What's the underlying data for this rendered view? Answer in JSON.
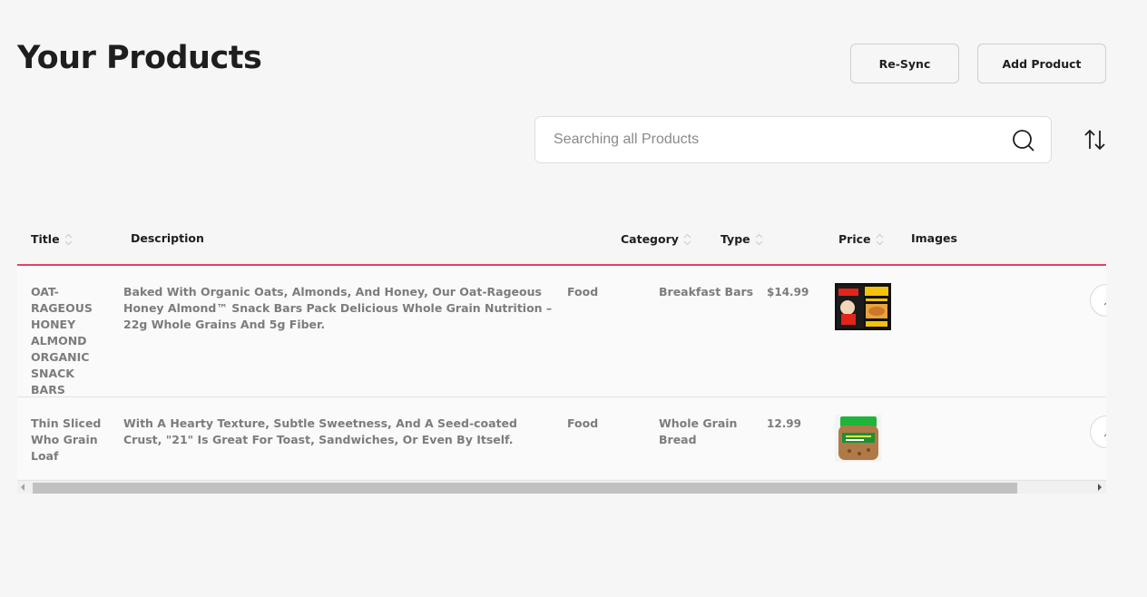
{
  "page": {
    "title": "Your Products"
  },
  "toolbar": {
    "resync_label": "Re-Sync",
    "add_label": "Add Product"
  },
  "search": {
    "placeholder": "Searching all Products",
    "value": ""
  },
  "table": {
    "columns": [
      "Title",
      "Description",
      "Category",
      "Type",
      "Price",
      "Images"
    ],
    "rows": [
      {
        "title": "OAT-RAGEOUS HONEY ALMOND ORGANIC SNACK BARS",
        "description": "Baked With Organic Oats, Almonds, And Honey, Our Oat-Rageous Honey Almond™ Snack Bars Pack Delicious Whole Grain Nutrition – 22g Whole Grains And 5g Fiber.",
        "category": "Food",
        "type": "Breakfast Bars",
        "price": "$14.99",
        "image": "snack-bar-box-thumbnail"
      },
      {
        "title": "Thin Sliced Who Grain Loaf",
        "description": "With A Hearty Texture, Subtle Sweetness, And A Seed-coated Crust, \"21\" Is Great For Toast, Sandwiches, Or Even By Itself.",
        "category": "Food",
        "type": "Whole Grain Bread",
        "price": "12.99",
        "image": "bread-loaf-thumbnail"
      }
    ]
  },
  "colors": {
    "accent": "#e0475f",
    "background": "#f6f6f6",
    "text_muted": "#7c7c7c"
  },
  "icons": {
    "search": "search-icon",
    "sort": "sort-toggle-icon",
    "edit": "edit-icon"
  }
}
